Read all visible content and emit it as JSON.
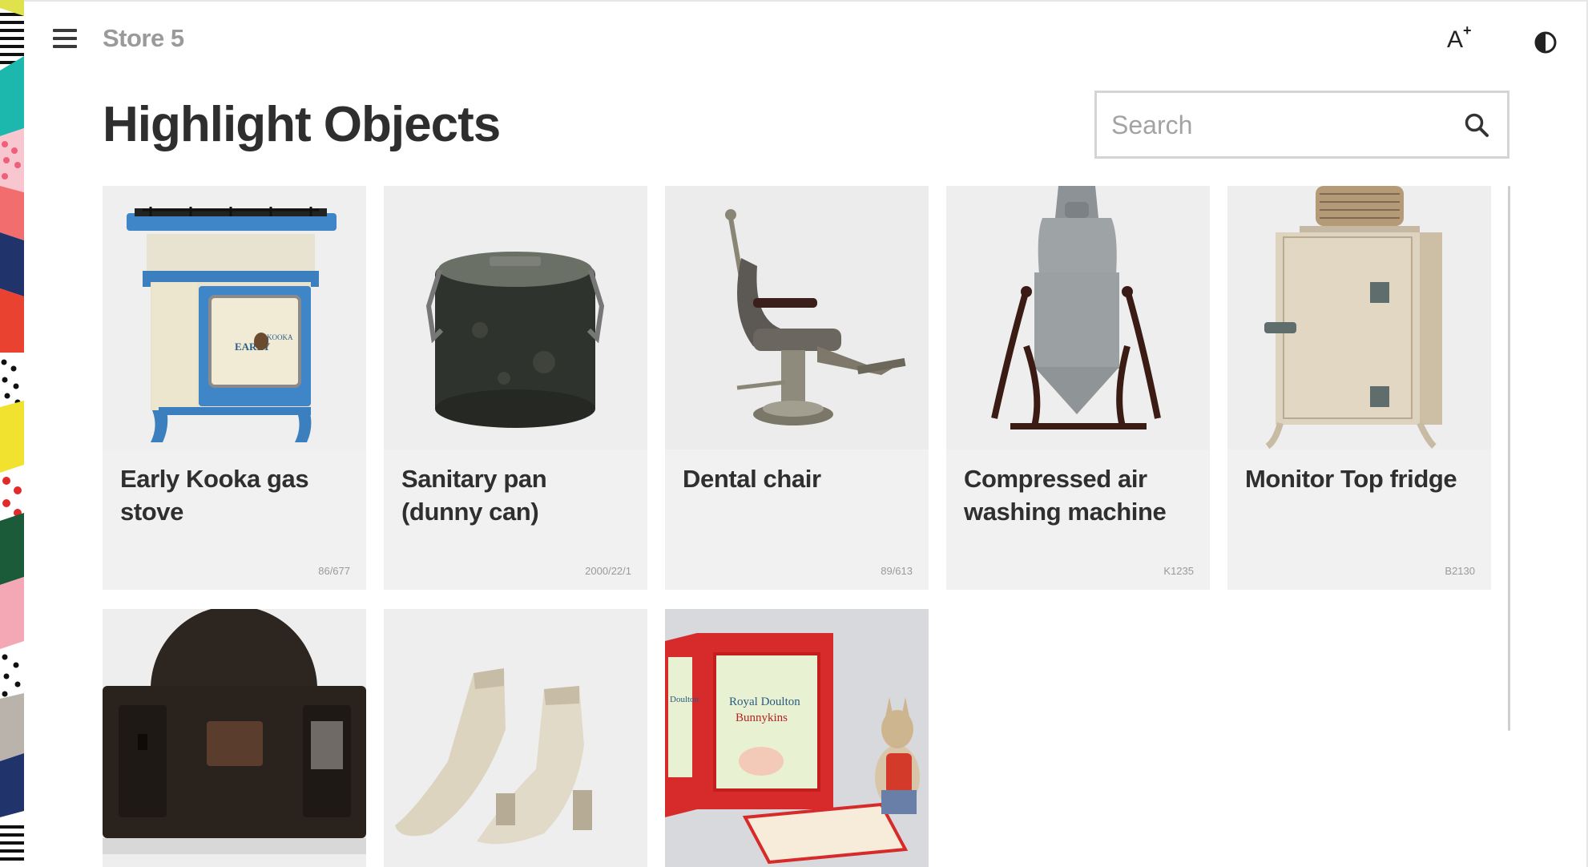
{
  "header": {
    "store_label": "Store 5",
    "font_size_label": "A",
    "font_size_sup": "+"
  },
  "page": {
    "title": "Highlight Objects"
  },
  "search": {
    "placeholder": "Search",
    "value": ""
  },
  "objects": [
    {
      "name": "Early Kooka gas stove",
      "reg": "86/677",
      "icon": "gas-stove"
    },
    {
      "name": "Sanitary pan (dunny can)",
      "reg": "2000/22/1",
      "icon": "dunny-can"
    },
    {
      "name": "Dental chair",
      "reg": "89/613",
      "icon": "dental-chair"
    },
    {
      "name": "Compressed air washing machine",
      "reg": "K1235",
      "icon": "washing-machine"
    },
    {
      "name": "Monitor Top fridge",
      "reg": "B2130",
      "icon": "fridge"
    },
    {
      "name": "",
      "reg": "",
      "icon": "black-machine"
    },
    {
      "name": "",
      "reg": "",
      "icon": "white-boots"
    },
    {
      "name": "",
      "reg": "",
      "icon": "bunnykins-box"
    }
  ],
  "box_text": {
    "line1": "Royal Doulton",
    "line2": "Bunnykins",
    "side": "Doulton"
  },
  "colors": {
    "card_bg": "#f1f1f1",
    "title": "#2e2e2e",
    "muted": "#9a9a9a"
  }
}
